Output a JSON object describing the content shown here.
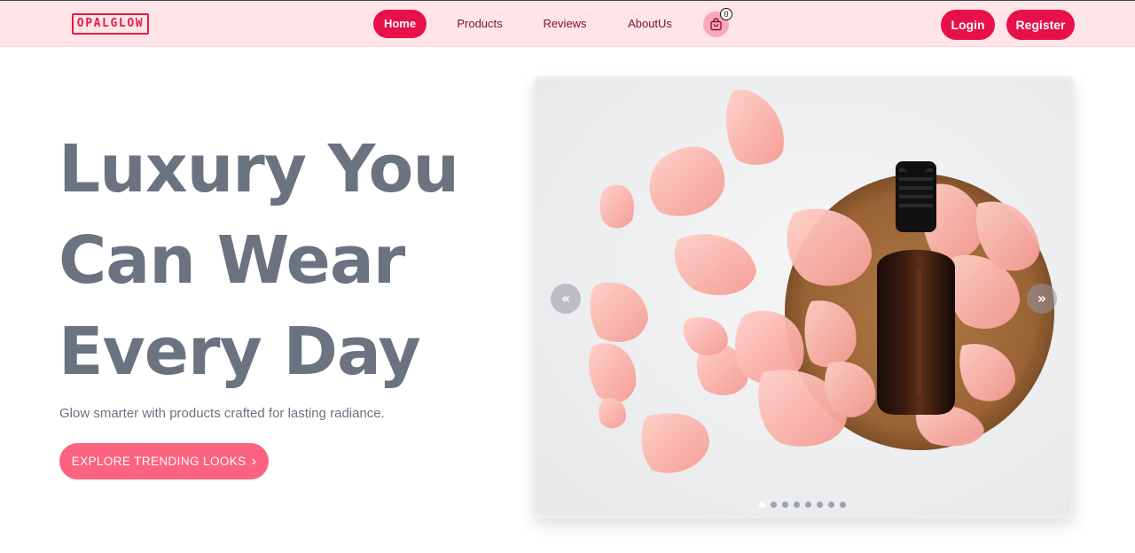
{
  "nav": {
    "logo": "OPALGLOW",
    "links": [
      {
        "label": "Home",
        "active": true
      },
      {
        "label": "Products",
        "active": false
      },
      {
        "label": "Reviews",
        "active": false
      },
      {
        "label": "AboutUs",
        "active": false
      }
    ],
    "cart_count": "0",
    "login_label": "Login",
    "register_label": "Register"
  },
  "hero": {
    "title_line1": "Luxury You",
    "title_line2": "Can Wear",
    "title_line3": "Every Day",
    "subtitle": "Glow smarter with products crafted for lasting radiance.",
    "cta_label": "EXPLORE TRENDING LOOKS"
  },
  "carousel": {
    "prev_label": "«",
    "next_label": "»",
    "slide_count": 8,
    "active_slide": 1
  },
  "colors": {
    "accent": "#e8104a",
    "cta": "#fb6380",
    "nav_bg": "#ffe4e8",
    "title_gray": "#6b7280"
  },
  "icons": {
    "cart": "shopping-bag-icon",
    "prev": "double-chevron-left-icon",
    "next": "double-chevron-right-icon",
    "cta_chevron": "chevron-right-icon"
  }
}
